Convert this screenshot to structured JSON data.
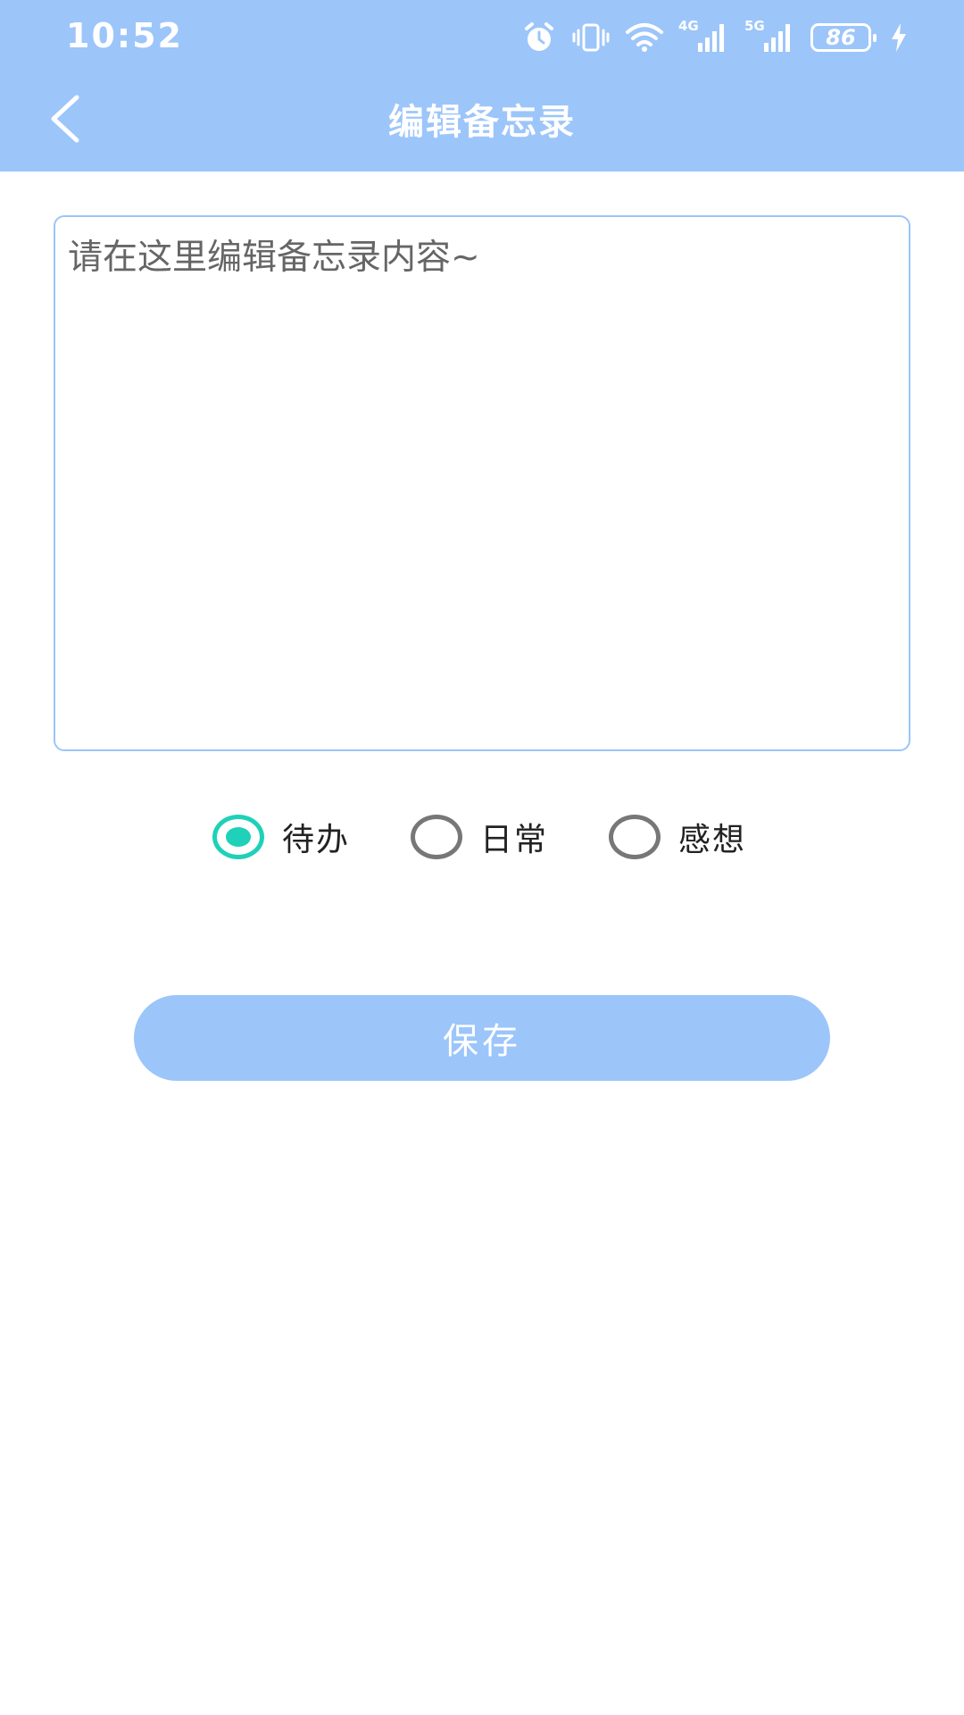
{
  "status_bar": {
    "time": "10:52",
    "battery_level": "86",
    "network_4g": "4G",
    "network_5g": "5G",
    "icons": [
      "alarm-icon",
      "vibrate-icon",
      "wifi-icon",
      "signal-4g-icon",
      "signal-5g-icon",
      "battery-icon",
      "charging-icon"
    ]
  },
  "header": {
    "title": "编辑备忘录",
    "back_icon": "chevron-left-icon"
  },
  "editor": {
    "value": "",
    "placeholder": "请在这里编辑备忘录内容~"
  },
  "category": {
    "options": [
      {
        "label": "待办",
        "checked": true
      },
      {
        "label": "日常",
        "checked": false
      },
      {
        "label": "感想",
        "checked": false
      }
    ]
  },
  "actions": {
    "save_label": "保存"
  },
  "colors": {
    "primary": "#9cc5fa",
    "radio_checked": "#1ed1b8",
    "radio_unchecked": "#777777",
    "background": "#ffffff"
  }
}
